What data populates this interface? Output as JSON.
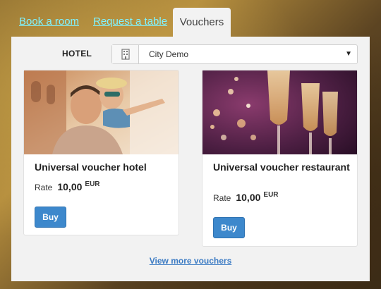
{
  "tabs": {
    "book_room": "Book a room",
    "request_table": "Request a table",
    "vouchers": "Vouchers"
  },
  "hotel_filter": {
    "label": "HOTEL",
    "selected": "City Demo",
    "icon": "building-icon"
  },
  "vouchers": [
    {
      "title": "Universal voucher hotel",
      "rate_label": "Rate",
      "amount": "10,00",
      "currency": "EUR",
      "buy_label": "Buy",
      "image": "couple-piggyback-photo"
    },
    {
      "title": "Universal voucher restaurant",
      "rate_label": "Rate",
      "amount": "10,00",
      "currency": "EUR",
      "buy_label": "Buy",
      "image": "champagne-glasses-photo"
    }
  ],
  "more_link": "View more vouchers",
  "colors": {
    "tab_link": "#7ff3ff",
    "buy_button": "#3d88cc",
    "more_link": "#3d7cc4",
    "panel": "#f2f2f2"
  }
}
